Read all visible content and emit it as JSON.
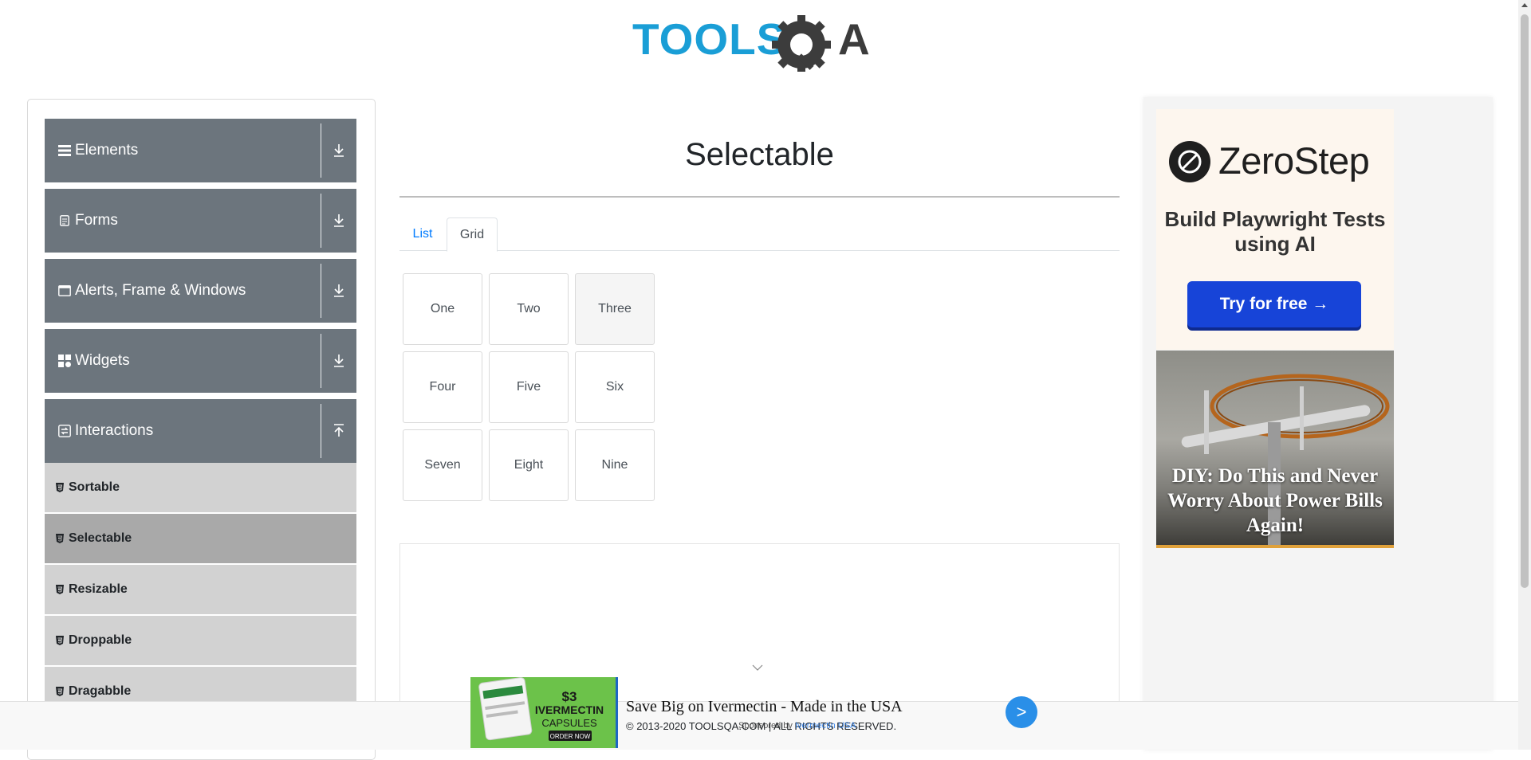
{
  "header": {
    "logo_text": "TOOLSQA"
  },
  "sidebar": {
    "groups": [
      {
        "title": "Elements",
        "icon": "hamburger-icon"
      },
      {
        "title": "Forms",
        "icon": "document-icon"
      },
      {
        "title": "Alerts, Frame & Windows",
        "icon": "window-icon"
      },
      {
        "title": "Widgets",
        "icon": "widgets-icon"
      },
      {
        "title": "Interactions",
        "icon": "interactions-icon"
      }
    ],
    "sub_items": [
      {
        "label": "Sortable"
      },
      {
        "label": "Selectable"
      },
      {
        "label": "Resizable"
      },
      {
        "label": "Droppable"
      },
      {
        "label": "Dragabble"
      }
    ]
  },
  "main": {
    "title": "Selectable",
    "tabs": [
      {
        "label": "List"
      },
      {
        "label": "Grid"
      }
    ],
    "active_tab": "Grid",
    "grid": [
      [
        "One",
        "Two",
        "Three"
      ],
      [
        "Four",
        "Five",
        "Six"
      ],
      [
        "Seven",
        "Eight",
        "Nine"
      ]
    ]
  },
  "right_ad": {
    "brand": "ZeroStep",
    "tagline": "Build Playwright Tests using AI",
    "button": "Try for free →",
    "story": "DIY: Do This and Never Worry About Power Bills Again!"
  },
  "bottom_ad": {
    "badge_price": "$3",
    "badge_product": "IVERMECTIN",
    "badge_form": "CAPSULES",
    "badge_cta": "ORDER NOW",
    "title": "Save Big on Ivermectin - Made in the USA",
    "go": ">"
  },
  "footer": {
    "copyright": "© 2013-2020 TOOLSQA.COM | ALL RIGHTS RESERVED.",
    "sponsored_prefix": "Sponsored by",
    "sponsored_link": "Ivermectin USA"
  },
  "colors": {
    "brand_blue": "#1a9ed6",
    "group_bg": "#6c757d",
    "link": "#007bff"
  }
}
